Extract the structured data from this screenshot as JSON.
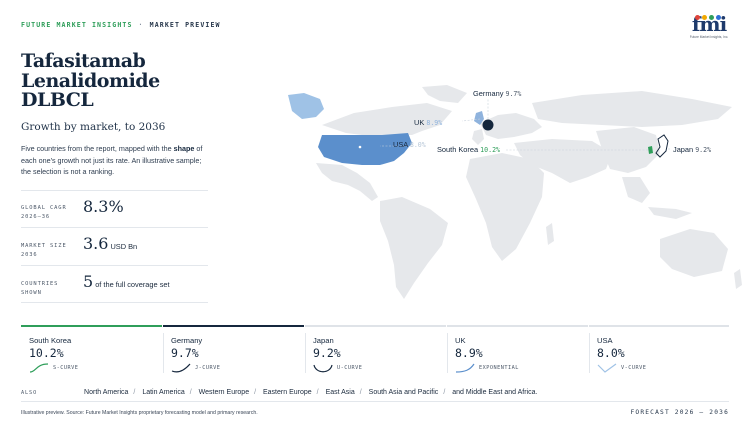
{
  "header": {
    "brand": "FUTURE MARKET INSIGHTS",
    "separator": "·",
    "section": "MARKET PREVIEW"
  },
  "logo": {
    "text": "fmi",
    "tagline": "Future Market Insights, Inc."
  },
  "title": "Tafasitamab Lenalidomide DLBCL",
  "subtitle": "Growth by market, to 2036",
  "description": {
    "part1": "Five countries from the report, mapped with the ",
    "bold": "shape",
    "part2": " of each one's growth not just its rate. An illustrative sample; the selection is not a ranking."
  },
  "kpis": {
    "cagr": {
      "label_line1": "GLOBAL CAGR",
      "label_line2": "2026–36",
      "value": "8.3%"
    },
    "size": {
      "label_line1": "MARKET SIZE",
      "label_line2": "2036",
      "value": "3.6",
      "unit": "USD Bn"
    },
    "countries": {
      "label_line1": "COUNTRIES",
      "label_line2": "SHOWN",
      "value": "5",
      "unit": "of the full coverage set"
    }
  },
  "map_labels": [
    {
      "name": "Germany",
      "value": "9.7%"
    },
    {
      "name": "UK",
      "value": "8.9%"
    },
    {
      "name": "USA",
      "value": "8.0%"
    },
    {
      "name": "South Korea",
      "value": "10.2%"
    },
    {
      "name": "Japan",
      "value": "9.2%"
    }
  ],
  "cards": [
    {
      "country": "South Korea",
      "value": "10.2%",
      "curve": "S-CURVE"
    },
    {
      "country": "Germany",
      "value": "9.7%",
      "curve": "J-CURVE"
    },
    {
      "country": "Japan",
      "value": "9.2%",
      "curve": "U-CURVE"
    },
    {
      "country": "UK",
      "value": "8.9%",
      "curve": "EXPONENTIAL"
    },
    {
      "country": "USA",
      "value": "8.0%",
      "curve": "V-CURVE"
    }
  ],
  "also": {
    "label": "ALSO",
    "regions": [
      "North America",
      "Latin America",
      "Western Europe",
      "Eastern Europe",
      "East Asia",
      "South Asia and Pacific",
      "and Middle East and Africa."
    ]
  },
  "footer": {
    "note": "Illustrative preview. Source: Future Market Insights proprietary forecasting model and primary research.",
    "forecast": "FORECAST 2026 – 2036"
  },
  "colors": {
    "brand_green": "#2f9e5a",
    "navy": "#15273d",
    "accent_blue": "#5b8fcc",
    "land": "#e6e8eb",
    "highlight_green": "#2f9e5a"
  }
}
